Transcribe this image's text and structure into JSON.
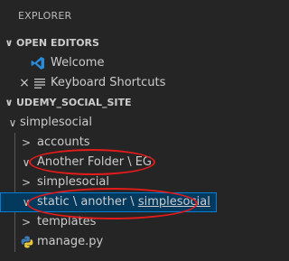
{
  "explorer": {
    "title": "EXPLORER"
  },
  "open_editors": {
    "header": "OPEN EDITORS",
    "chevron": "∨",
    "items": [
      {
        "label": "Welcome",
        "icon": "vscode-icon"
      },
      {
        "label": "Keyboard Shortcuts",
        "icon": "list-icon",
        "close": "×"
      }
    ]
  },
  "workspace": {
    "header": "UDEMY_SOCIAL_SITE",
    "chevron": "∨",
    "root": {
      "label": "simplesocial",
      "chevron": "∨"
    },
    "items": [
      {
        "label": "accounts",
        "chevron": ">"
      },
      {
        "label": "Another Folder \\ EG",
        "chevron": "∨"
      },
      {
        "label": "simplesocial",
        "chevron": ">"
      },
      {
        "label": "static \\ another \\ ",
        "label_underlined": "simplesocial",
        "chevron": "∨"
      },
      {
        "label": "templates",
        "chevron": ">"
      },
      {
        "label": "manage.py",
        "icon": "python-icon"
      }
    ]
  },
  "annotation_color": "#e31b1b",
  "selection_color": "#04395e"
}
